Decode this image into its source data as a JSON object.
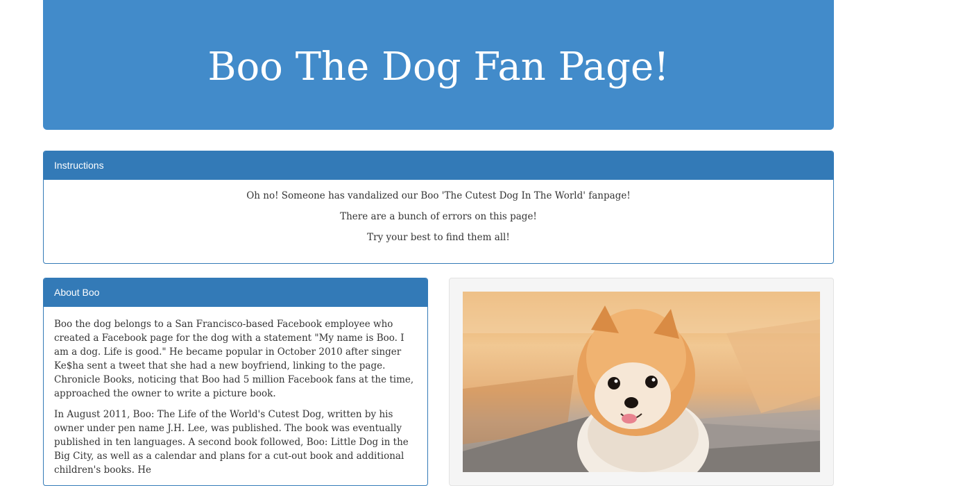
{
  "header": {
    "title": "Boo The Dog Fan Page!"
  },
  "instructions": {
    "heading": "Instructions",
    "lines": [
      "Oh no! Someone has vandalized our Boo 'The Cutest Dog In The World' fanpage!",
      "There are a bunch of errors on this page!",
      "Try your best to find them all!"
    ]
  },
  "about": {
    "heading": "About Boo",
    "paragraphs": [
      "Boo the dog belongs to a San Francisco-based Facebook employee who created a Facebook page for the dog with a statement \"My name is Boo. I am a dog. Life is good.\" He became popular in October 2010 after singer Ke$ha sent a tweet that she had a new boyfriend, linking to the page. Chronicle Books, noticing that Boo had 5 million Facebook fans at the time, approached the owner to write a picture book.",
      "In August 2011, Boo: The Life of the World's Cutest Dog, written by his owner under pen name J.H. Lee, was published. The book was eventually published in ten languages. A second book followed, Boo: Little Dog in the Big City, as well as a calendar and plans for a cut-out book and additional children's books. He"
    ]
  },
  "photo": {
    "subject": "pomeranian-dog"
  },
  "colors": {
    "primary": "#428bca",
    "panel_primary": "#337ab7",
    "well_bg": "#f5f5f5"
  }
}
